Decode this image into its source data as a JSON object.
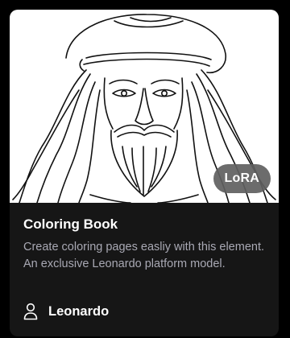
{
  "card": {
    "badge": "LoRA",
    "title": "Coloring Book",
    "description": "Create coloring pages easliy with this element. An exclusive Leonardo platform model.",
    "creator": "Leonardo",
    "creator_icon": "user-icon",
    "image": "coloring-book-portrait-illustration"
  }
}
